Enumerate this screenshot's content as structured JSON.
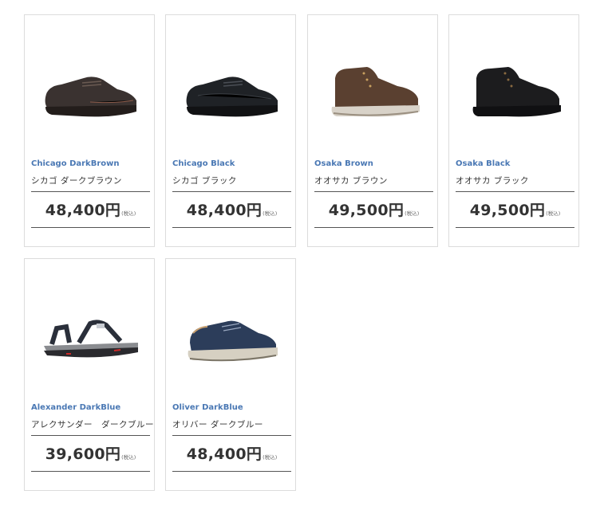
{
  "products": [
    {
      "name_en": "Chicago DarkBrown",
      "name_ja": "シカゴ ダークブラウン",
      "price": "48,400円",
      "tax": "(税込)",
      "icon": "shoe-icon",
      "color": "#3a3230"
    },
    {
      "name_en": "Chicago Black",
      "name_ja": "シカゴ ブラック",
      "price": "48,400円",
      "tax": "(税込)",
      "icon": "shoe-icon",
      "color": "#1f2226"
    },
    {
      "name_en": "Osaka Brown",
      "name_ja": "オオサカ ブラウン",
      "price": "49,500円",
      "tax": "(税込)",
      "icon": "boot-icon",
      "color": "#5a4030"
    },
    {
      "name_en": "Osaka Black",
      "name_ja": "オオサカ ブラック",
      "price": "49,500円",
      "tax": "(税込)",
      "icon": "boot-icon",
      "color": "#1c1c1e"
    },
    {
      "name_en": "Alexander DarkBlue",
      "name_ja": "アレクサンダー　ダークブルー",
      "price": "39,600円",
      "tax": "(税込)",
      "icon": "sandal-icon",
      "color": "#2a2f3a"
    },
    {
      "name_en": "Oliver DarkBlue",
      "name_ja": "オリバー ダークブルー",
      "price": "48,400円",
      "tax": "(税込)",
      "icon": "sneaker-icon",
      "color": "#2c3d5a"
    }
  ]
}
